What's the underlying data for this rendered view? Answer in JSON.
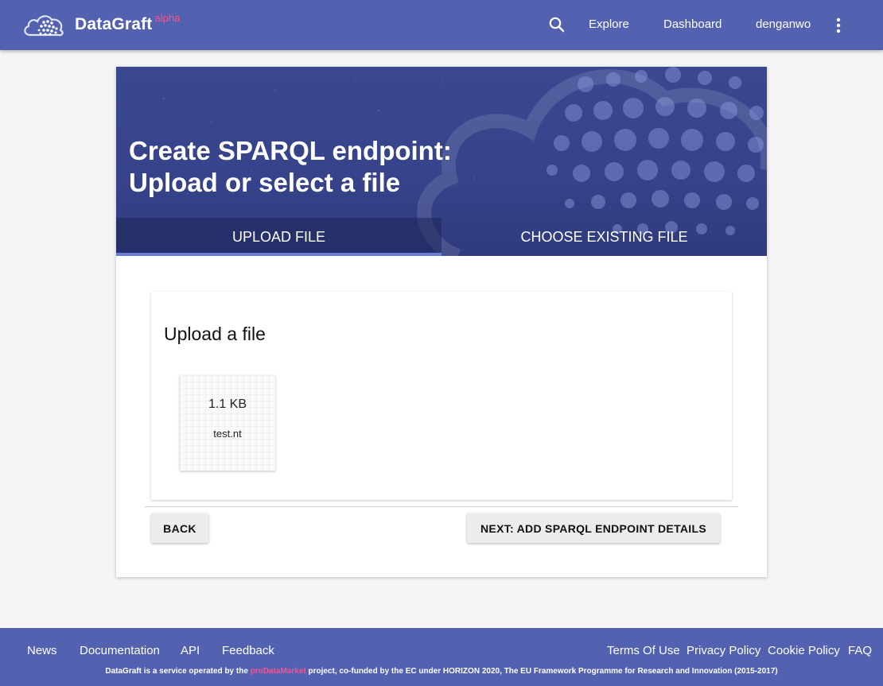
{
  "header": {
    "brand_name": "DataGraft",
    "brand_tag": "alpha",
    "nav": {
      "explore": "Explore",
      "dashboard": "Dashboard",
      "user": "denganwo"
    }
  },
  "hero": {
    "title_line1": "Create SPARQL endpoint:",
    "title_line2": "Upload or select a file"
  },
  "tabs": [
    {
      "label": "UPLOAD FILE",
      "active": true
    },
    {
      "label": "CHOOSE EXISTING FILE",
      "active": false
    }
  ],
  "panel": {
    "title": "Upload a file",
    "file": {
      "size": "1.1 KB",
      "name": "test.nt"
    }
  },
  "buttons": {
    "back": "BACK",
    "next": "NEXT: ADD SPARQL ENDPOINT DETAILS"
  },
  "footer": {
    "left_links": [
      "News",
      "Documentation",
      "API",
      "Feedback"
    ],
    "right_links": [
      "Terms Of Use",
      "Privacy Policy",
      "Cookie Policy",
      "FAQ"
    ],
    "note_prefix": "DataGraft is a service operated by the ",
    "note_brand": "proDataMarket",
    "note_suffix": " project, co-funded by the EC under HORIZON 2020, The EU Framework Programme for Research and Innovation (2015-2017)"
  },
  "colors": {
    "primary": "#5262b1",
    "hero": "#36438a",
    "accent": "#ff4f8b",
    "tab_indicator": "#6a7fd1"
  },
  "icons": {
    "logo": "cloud-dots-logo",
    "search": "search-icon",
    "more": "more-vert-icon"
  }
}
